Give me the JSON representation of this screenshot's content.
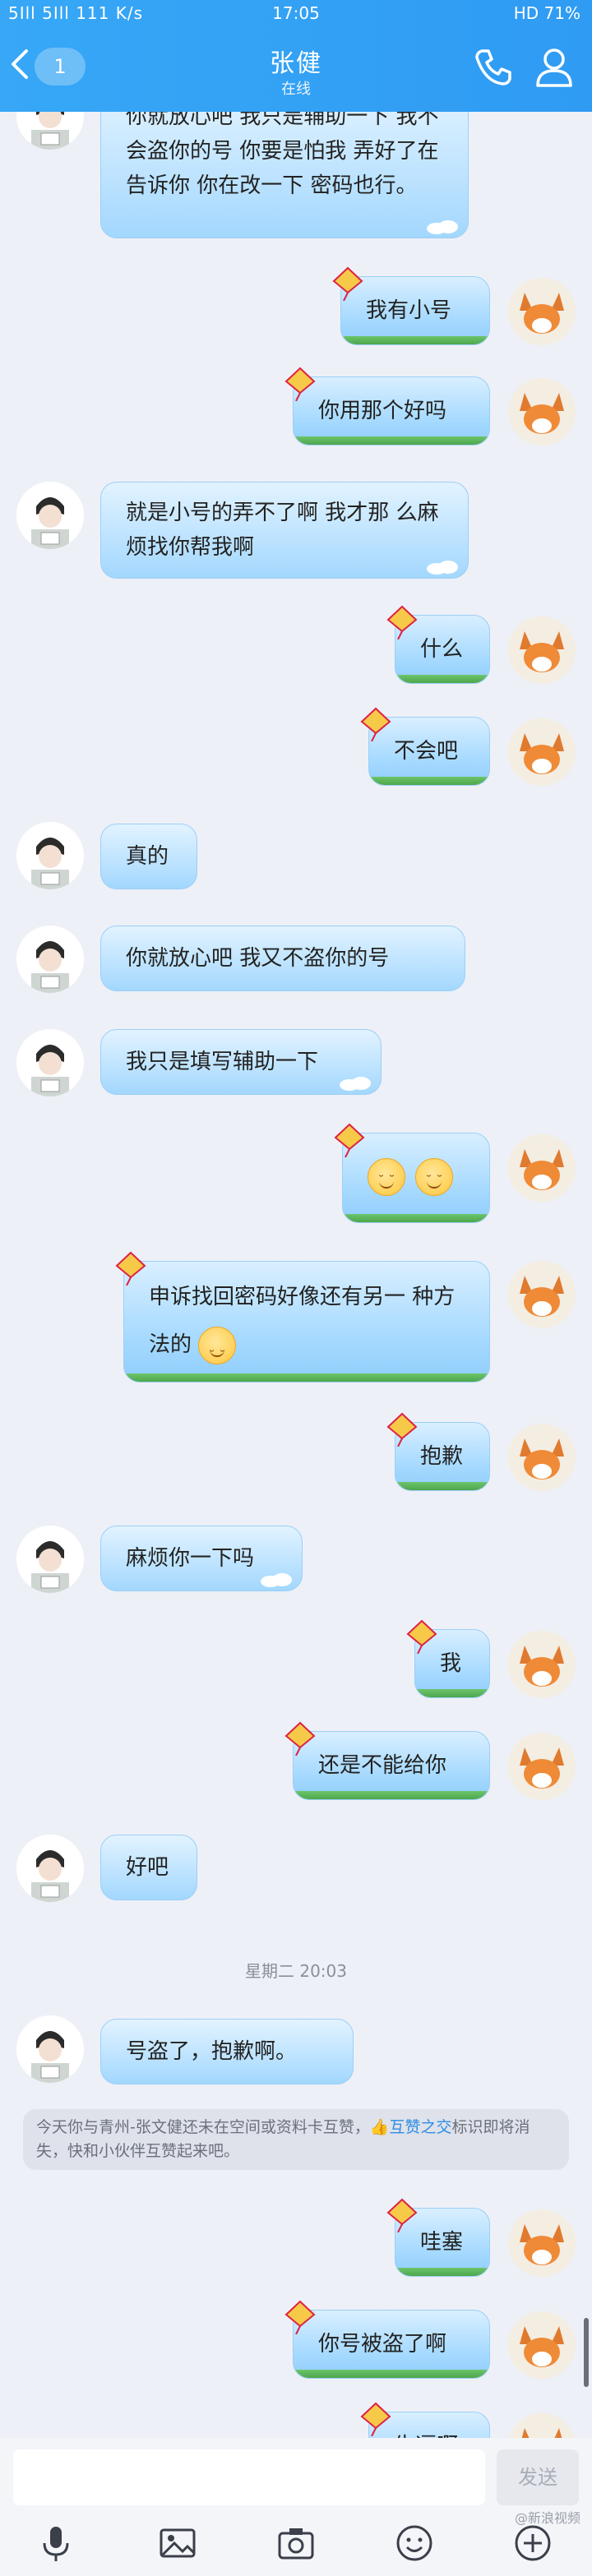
{
  "status_bar": {
    "left": "5Ill 5Ill 111 K/s",
    "time": "17:05",
    "right": "HD 71%"
  },
  "header": {
    "back_count": "1",
    "title": "张健",
    "subtitle": "在线"
  },
  "messages": [
    {
      "from": "them",
      "text": "你就放心吧 我只是辅助一下 我不会盗你的号 你要是怕我 弄好了在告诉你 你在改一下 密码也行。"
    },
    {
      "from": "me",
      "text": "我有小号"
    },
    {
      "from": "me",
      "text": "你用那个好吗"
    },
    {
      "from": "them",
      "text": "就是小号的弄不了啊 我才那 么麻烦找你帮我啊"
    },
    {
      "from": "me",
      "text": "什么"
    },
    {
      "from": "me",
      "text": "不会吧"
    },
    {
      "from": "them",
      "text": "真的"
    },
    {
      "from": "them",
      "text": "你就放心吧 我又不盗你的号"
    },
    {
      "from": "them",
      "text": "我只是填写辅助一下"
    },
    {
      "from": "me",
      "text": ""
    },
    {
      "from": "me",
      "text": "申诉找回密码好像还有另一 种方法的"
    },
    {
      "from": "me",
      "text": "抱歉"
    },
    {
      "from": "them",
      "text": "麻烦你一下吗"
    },
    {
      "from": "me",
      "text": "我"
    },
    {
      "from": "me",
      "text": "还是不能给你"
    },
    {
      "from": "them",
      "text": "好吧"
    },
    {
      "from": "them",
      "text": "号盗了，抱歉啊。"
    },
    {
      "from": "me",
      "text": "哇塞"
    },
    {
      "from": "me",
      "text": "你号被盗了啊"
    },
    {
      "from": "me",
      "text": "牛逼啊"
    }
  ],
  "timestamp": "星期二 20:03",
  "system_notice": {
    "text_before": "今天你与青州-张文健还未在空间或资料卡互赞，",
    "link": "互赞之交",
    "text_after": "标识即将消失，快和小伙伴互赞起来吧。"
  },
  "input": {
    "placeholder": "",
    "send_label": "发送"
  },
  "toolbar": [
    "microphone-icon",
    "image-icon",
    "camera-icon",
    "emoji-icon",
    "plus-icon"
  ],
  "watermark": "@新浪视频",
  "colors": {
    "header": "#2f9bf3",
    "bubble": "#a9dbff",
    "background": "#eef0f7"
  }
}
